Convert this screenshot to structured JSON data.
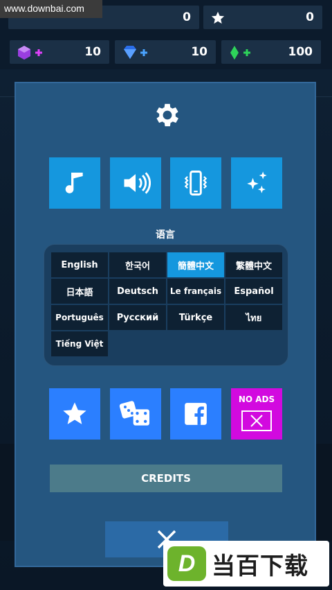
{
  "watermark_top": "www.downbai.com",
  "resources": {
    "top_left_value": "0",
    "stars_value": "0",
    "gems_purple": "10",
    "gems_blue": "10",
    "gems_green": "100"
  },
  "settings": {
    "toggles": [
      {
        "name": "music",
        "icon": "music-note-icon"
      },
      {
        "name": "sound",
        "icon": "speaker-icon"
      },
      {
        "name": "vibration",
        "icon": "phone-vibrate-icon"
      },
      {
        "name": "effects",
        "icon": "sparkles-icon"
      }
    ],
    "language_title": "语言",
    "languages": [
      "English",
      "한국어",
      "簡體中文",
      "繁體中文",
      "日本語",
      "Deutsch",
      "Le français",
      "Español",
      "Português",
      "Русский",
      "Türkçe",
      "ไทย",
      "Tiếng Việt"
    ],
    "active_language": "簡體中文",
    "links": [
      {
        "name": "rate",
        "icon": "star-icon"
      },
      {
        "name": "more-games",
        "icon": "dice-icon"
      },
      {
        "name": "facebook",
        "icon": "facebook-icon"
      }
    ],
    "no_ads_label": "NO ADS",
    "credits_label": "CREDITS",
    "colors": {
      "panel": "#255680",
      "button": "#1597de",
      "no_ads": "#d20adf",
      "credits": "#4c7b8a",
      "link_button": "#2b7fff"
    }
  },
  "watermark_bottom": {
    "logo_letter": "D",
    "text": "当百下载"
  }
}
